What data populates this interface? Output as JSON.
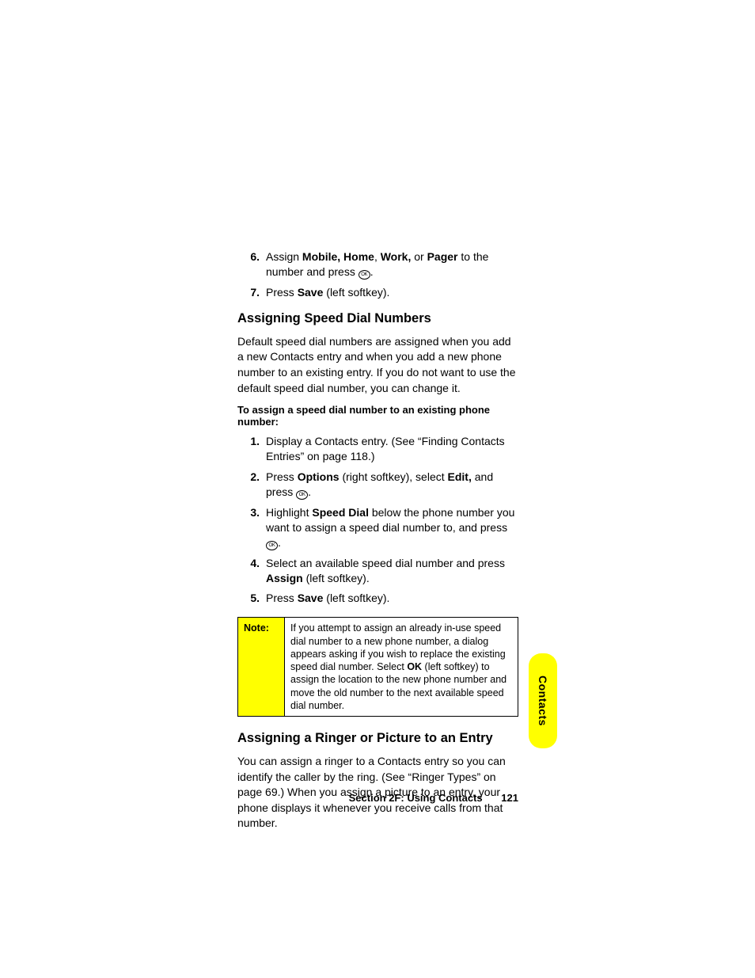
{
  "stepsTop": [
    {
      "num": "6.",
      "parts": [
        "Assign ",
        {
          "b": "Mobile, Home"
        },
        ", ",
        {
          "b": "Work,"
        },
        " or ",
        {
          "b": "Pager"
        },
        " to the number and press ",
        {
          "icon": true
        },
        "."
      ]
    },
    {
      "num": "7.",
      "parts": [
        "Press ",
        {
          "b": "Save"
        },
        " (left softkey)."
      ]
    }
  ],
  "heading1": "Assigning Speed Dial Numbers",
  "para1": "Default speed dial numbers are assigned when you add a new Contacts entry and when you add a new phone number to an existing entry. If you do not want to use the default speed dial number, you can change it.",
  "lead1": "To assign a speed dial number to an existing phone number:",
  "stepsMid": [
    {
      "num": "1.",
      "parts": [
        "Display a Contacts entry. (See “Finding Contacts Entries” on page 118.)"
      ]
    },
    {
      "num": "2.",
      "parts": [
        "Press ",
        {
          "b": "Options"
        },
        " (right softkey), select ",
        {
          "b": "Edit,"
        },
        " and press ",
        {
          "icon": true
        },
        "."
      ]
    },
    {
      "num": "3.",
      "parts": [
        "Highlight ",
        {
          "b": "Speed Dial"
        },
        " below the phone number you want to assign a speed dial number to, and press ",
        {
          "icon": true
        },
        "."
      ]
    },
    {
      "num": "4.",
      "parts": [
        "Select an available speed dial number and press ",
        {
          "b": "Assign"
        },
        " (left softkey)."
      ]
    },
    {
      "num": "5.",
      "parts": [
        "Press ",
        {
          "b": "Save"
        },
        " (left softkey)."
      ]
    }
  ],
  "note": {
    "label": "Note:",
    "parts": [
      "If you attempt to assign an already in-use speed dial number to a new phone number, a dialog appears asking if you wish to replace the existing speed dial number. Select ",
      {
        "b": "OK"
      },
      " (left softkey) to assign the location to the new phone number and move the old number to the next available speed dial number."
    ]
  },
  "heading2": "Assigning a Ringer or Picture to an Entry",
  "para2": "You can assign a ringer to a Contacts entry so you can identify the caller by the ring. (See “Ringer Types” on page 69.) When you assign a picture to an entry, your phone displays it whenever you receive calls from that number.",
  "tab": "Contacts",
  "footer": {
    "section": "Section 2F: Using Contacts",
    "page": "121"
  }
}
